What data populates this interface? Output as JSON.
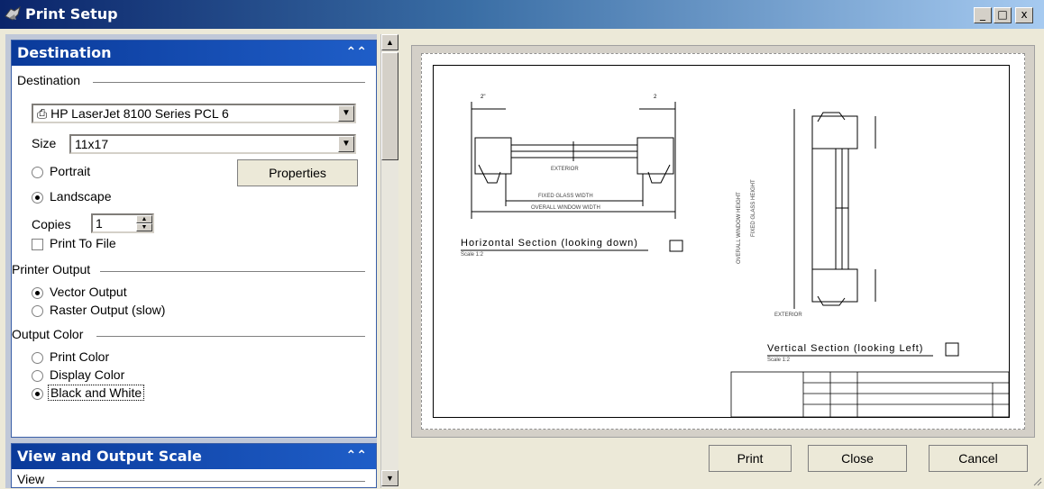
{
  "window": {
    "title": "Print Setup",
    "minimize": "_",
    "maximize": "□",
    "close": "x"
  },
  "destination_section": {
    "header": "Destination",
    "group_label": "Destination",
    "printer": "HP LaserJet 8100 Series PCL 6",
    "size_label": "Size",
    "size_value": "11x17",
    "portrait_label": "Portrait",
    "landscape_label": "Landscape",
    "properties_label": "Properties",
    "copies_label": "Copies",
    "copies_value": "1",
    "print_to_file_label": "Print To File",
    "orientation": "Landscape"
  },
  "printer_output": {
    "group_label": "Printer Output",
    "vector_label": "Vector Output",
    "raster_label": "Raster Output (slow)",
    "selected": "Vector Output"
  },
  "output_color": {
    "group_label": "Output Color",
    "print_color_label": "Print Color",
    "display_color_label": "Display Color",
    "bw_label": "Black and White",
    "selected": "Black and White"
  },
  "view_section": {
    "header": "View and Output Scale",
    "group_label": "View"
  },
  "preview": {
    "horizontal_title": "Horizontal Section (looking down)",
    "horizontal_scale": "Scale 1:2",
    "vertical_title": "Vertical Section (looking Left)",
    "vertical_scale": "Scale 1:2",
    "exterior": "EXTERIOR",
    "exterior_v": "EXTERIOR",
    "fixed_glass_width": "FIXED GLASS WIDTH",
    "overall_window_width": "OVERALL WINDOW WIDTH",
    "overall_window_height": "OVERALL WINDOW HEIGHT",
    "fixed_glass_height": "FIXED GLASS HEIGHT",
    "dim_left": "2\"",
    "dim_right": "2"
  },
  "buttons": {
    "print": "Print",
    "close": "Close",
    "cancel": "Cancel"
  },
  "colors": {
    "title_start": "#0a246a",
    "section_header": "#0a3a9a"
  }
}
